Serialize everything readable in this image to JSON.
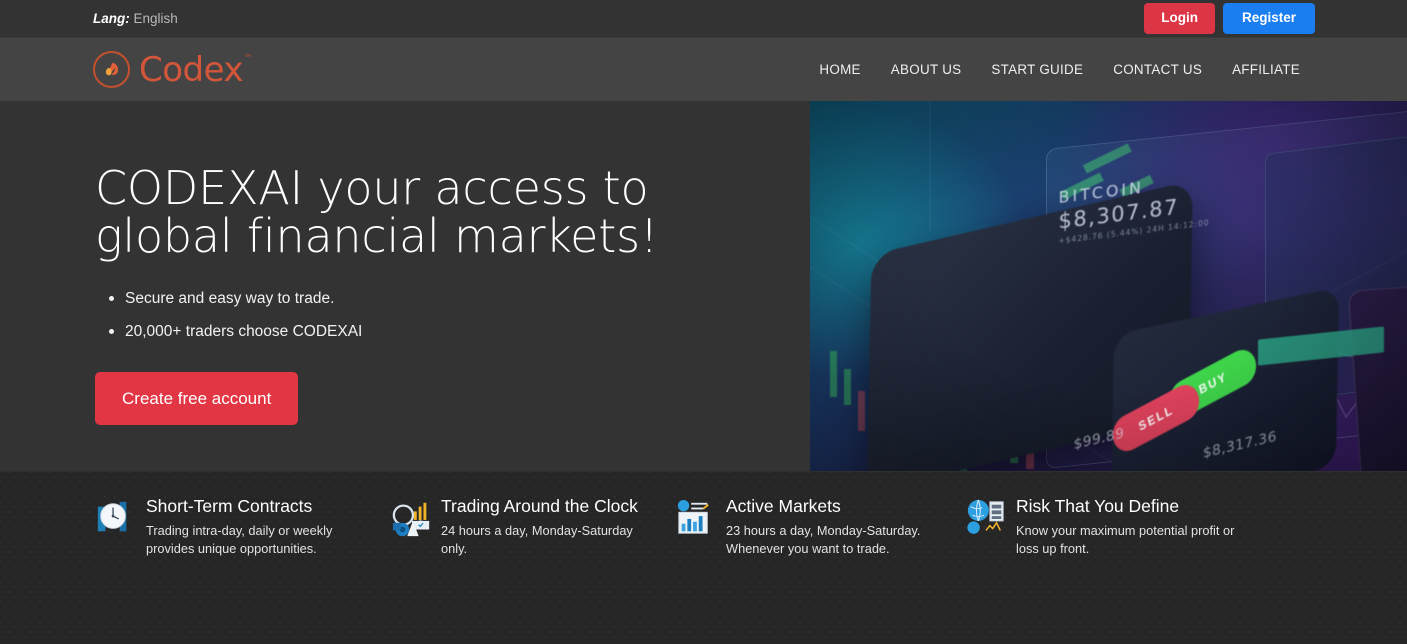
{
  "topbar": {
    "lang_label": "Lang:",
    "lang_value": "English",
    "login_label": "Login",
    "register_label": "Register",
    "login_color": "#dc3545",
    "register_color": "#1a7ef0"
  },
  "navbar": {
    "logo_text": "Codex",
    "logo_tm": "™",
    "logo_color": "#d4563a",
    "links": [
      {
        "label": "HOME"
      },
      {
        "label": "ABOUT US"
      },
      {
        "label": "START GUIDE"
      },
      {
        "label": "CONTACT US"
      },
      {
        "label": "AFFILIATE"
      }
    ]
  },
  "hero": {
    "title": "CODEXAI your access to global financial markets!",
    "bullets": [
      "Secure and easy way to trade.",
      "20,000+ traders choose CODEXAI"
    ],
    "cta_label": "Create free account",
    "cta_color": "#e23644",
    "image": {
      "ticker_name": "BITCOIN",
      "ticker_price": "$8,307.87",
      "ticker_change": "+$428.76 (5.44%) 24H 14:12:00",
      "buy_label": "BUY",
      "sell_label": "SELL",
      "amount_value": "$99.89",
      "average_cost_value": "$8,317.36",
      "buy_color": "#3ed44a",
      "sell_color": "#e0425c"
    }
  },
  "features": [
    {
      "icon": "clock-icon",
      "title": "Short-Term Contracts",
      "desc": "Trading intra-day, daily or weekly provides unique opportunities."
    },
    {
      "icon": "analytics-icon",
      "title": "Trading Around the Clock",
      "desc": "24 hours a day, Monday-Saturday only."
    },
    {
      "icon": "markets-chart-icon",
      "title": "Active Markets",
      "desc": "23 hours a day, Monday-Saturday. Whenever you want to trade."
    },
    {
      "icon": "globe-server-icon",
      "title": "Risk That You Define",
      "desc": "Know your maximum potential profit or loss up front."
    }
  ]
}
